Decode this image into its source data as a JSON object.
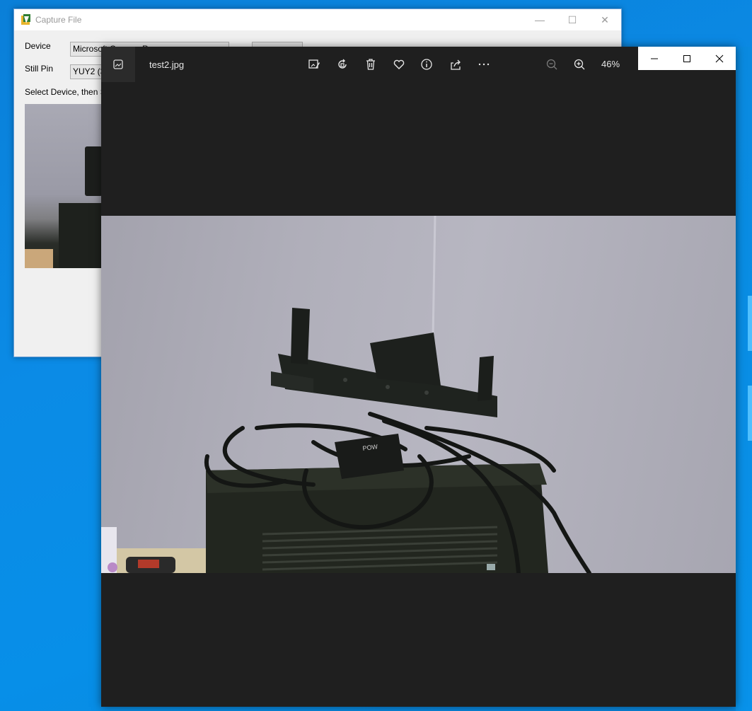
{
  "capture_window": {
    "title": "Capture File",
    "device_label": "Device",
    "device_value": "Microsoft Camera R",
    "still_pin_label": "Still Pin",
    "still_pin_value": "YUY2 (3",
    "instruction": "Select Device, then Se"
  },
  "photos_window": {
    "filename": "test2.jpg",
    "zoom_level": "46%",
    "toolbar_icons": [
      "edit-image-icon",
      "rotate-icon",
      "delete-icon",
      "favorite-icon",
      "info-icon",
      "share-icon",
      "more-icon",
      "zoom-out-icon",
      "zoom-in-icon"
    ],
    "photo_text": [
      "POW"
    ]
  },
  "colors": {
    "desktop_blue": "#0a86dd",
    "viewer_background": "#1f1f1f",
    "viewer_text": "#e6e6e6"
  }
}
